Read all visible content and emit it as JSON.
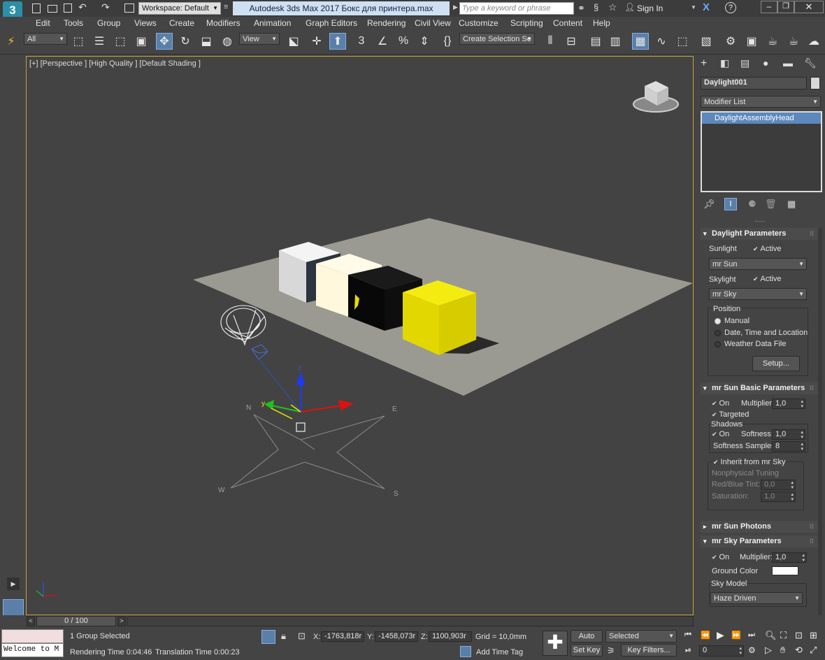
{
  "titlebar": {
    "app_logo": "3",
    "workspace": "Workspace: Default",
    "title": "Autodesk 3ds Max 2017     Бокс для принтера.max",
    "search_placeholder": "Type a keyword or phrase",
    "sign_in": "Sign In"
  },
  "menu": [
    "Edit",
    "Tools",
    "Group",
    "Views",
    "Create",
    "Modifiers",
    "Animation",
    "Graph Editors",
    "Rendering",
    "Civil View",
    "Customize",
    "Scripting",
    "Content",
    "Help"
  ],
  "toolbar": {
    "selection_filter": "All",
    "ref_coord": "View",
    "selection_set": "Create Selection Se"
  },
  "viewport": {
    "label": "[+] [Perspective ] [High Quality ] [Default Shading ]",
    "compass": {
      "n": "N",
      "e": "E",
      "s": "S",
      "w": "W"
    },
    "axes": {
      "x": "x",
      "y": "y",
      "z": "z"
    },
    "colors": {
      "ground": "#9a9a92",
      "white_box": "#e8e8e8",
      "cream_box": "#fffbe4",
      "black_box": "#0a0a0a",
      "yellow_box": "#e6dc00",
      "frame": "#c9a23a"
    }
  },
  "timeline": {
    "position": "0 / 100"
  },
  "cmdpanel": {
    "object_name": "Daylight001",
    "modifier_list": "Modifier List",
    "stack_item": "DaylightAssemblyHead",
    "daylight": {
      "title": "Daylight Parameters",
      "sunlight": "Sunlight",
      "sun_active": "Active",
      "sun_type": "mr Sun",
      "skylight": "Skylight",
      "sky_active": "Active",
      "sky_type": "mr Sky",
      "position": "Position",
      "manual": "Manual",
      "date_time": "Date, Time and Location",
      "weather": "Weather Data File",
      "setup": "Setup..."
    },
    "sun_basic": {
      "title": "mr Sun Basic Parameters",
      "on": "On",
      "multiplier_label": "Multiplier:",
      "multiplier": "1,0",
      "targeted": "Targeted",
      "shadows": "Shadows",
      "shadows_on": "On",
      "softness_label": "Softness:",
      "softness": "1,0",
      "samples_label": "Softness Samples:",
      "samples": "8",
      "inherit": "Inherit from mr Sky",
      "nonphysical": "Nonphysical Tuning",
      "redblue_label": "Red/Blue Tint:",
      "redblue": "0,0",
      "saturation_label": "Saturation:",
      "saturation": "1,0"
    },
    "sun_photons": {
      "title": "mr Sun Photons"
    },
    "sky_params": {
      "title": "mr Sky Parameters",
      "on": "On",
      "multiplier_label": "Multiplier:",
      "multiplier": "1,0",
      "ground_color": "Ground Color",
      "ground_swatch": "#ffffff",
      "sky_model": "Sky Model",
      "model_value": "Haze Driven"
    }
  },
  "status": {
    "welcome": "Welcome to M",
    "selected": "1 Group Selected",
    "render_time": "Rendering Time  0:04:46",
    "translation_time": "Translation Time  0:00:23",
    "x_label": "X:",
    "x": "-1763,818r",
    "y_label": "Y:",
    "y": "-1458,073r",
    "z_label": "Z:",
    "z": "1100,903r",
    "grid": "Grid = 10,0mm",
    "add_time_tag": "Add Time Tag",
    "auto_key": "Auto Key",
    "set_key": "Set Key",
    "selected_dd": "Selected",
    "key_filters": "Key Filters...",
    "frame": "0"
  }
}
